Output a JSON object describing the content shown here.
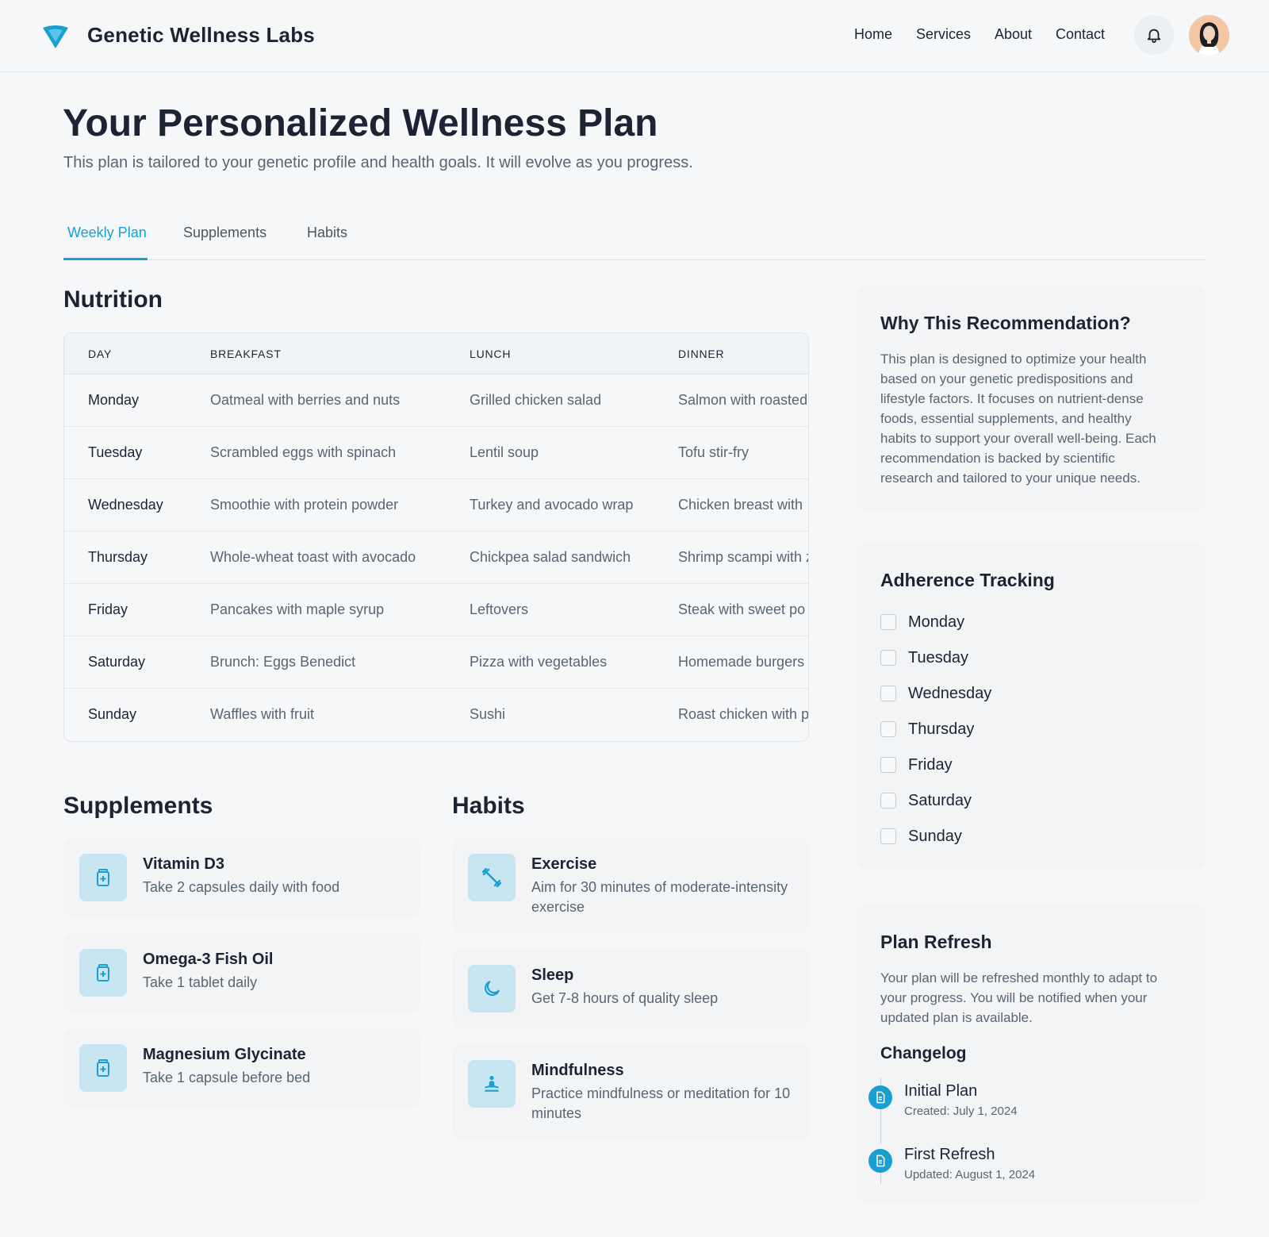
{
  "brand": {
    "name": "Genetic Wellness Labs",
    "accent": "#1a9fd2"
  },
  "nav": {
    "home": "Home",
    "services": "Services",
    "about": "About",
    "contact": "Contact"
  },
  "page": {
    "title": "Your Personalized Wellness Plan",
    "subtitle": "This plan is tailored to your genetic profile and health goals. It will evolve as you progress."
  },
  "tabs": [
    {
      "label": "Weekly Plan",
      "active": true
    },
    {
      "label": "Supplements",
      "active": false
    },
    {
      "label": "Habits",
      "active": false
    }
  ],
  "nutrition": {
    "heading": "Nutrition",
    "columns": [
      "DAY",
      "BREAKFAST",
      "LUNCH",
      "DINNER"
    ],
    "rows": [
      {
        "day": "Monday",
        "breakfast": "Oatmeal with berries and nuts",
        "lunch": "Grilled chicken salad",
        "dinner": "Salmon with roasted"
      },
      {
        "day": "Tuesday",
        "breakfast": "Scrambled eggs with spinach",
        "lunch": "Lentil soup",
        "dinner": "Tofu stir-fry"
      },
      {
        "day": "Wednesday",
        "breakfast": "Smoothie with protein powder",
        "lunch": "Turkey and avocado wrap",
        "dinner": "Chicken breast with"
      },
      {
        "day": "Thursday",
        "breakfast": "Whole-wheat toast with avocado",
        "lunch": "Chickpea salad sandwich",
        "dinner": "Shrimp scampi with z"
      },
      {
        "day": "Friday",
        "breakfast": "Pancakes with maple syrup",
        "lunch": "Leftovers",
        "dinner": "Steak with sweet po"
      },
      {
        "day": "Saturday",
        "breakfast": "Brunch: Eggs Benedict",
        "lunch": "Pizza with vegetables",
        "dinner": "Homemade burgers"
      },
      {
        "day": "Sunday",
        "breakfast": "Waffles with fruit",
        "lunch": "Sushi",
        "dinner": "Roast chicken with p"
      }
    ]
  },
  "supplements": {
    "heading": "Supplements",
    "items": [
      {
        "name": "Vitamin D3",
        "desc": "Take 2 capsules daily with food",
        "icon": "pill-bottle-icon"
      },
      {
        "name": "Omega-3 Fish Oil",
        "desc": "Take 1 tablet daily",
        "icon": "pill-bottle-icon"
      },
      {
        "name": "Magnesium Glycinate",
        "desc": "Take 1 capsule before bed",
        "icon": "pill-bottle-icon"
      }
    ]
  },
  "habits": {
    "heading": "Habits",
    "items": [
      {
        "name": "Exercise",
        "desc_line1": "Aim for 30 minutes of moderate-intensity",
        "desc_line2": "exercise",
        "icon": "dumbbell-icon"
      },
      {
        "name": "Sleep",
        "desc_line1": "Get 7-8 hours of quality sleep",
        "icon": "moon-icon"
      },
      {
        "name": "Mindfulness",
        "desc_line1": "Practice mindfulness or meditation for 10",
        "desc_line2": "minutes",
        "icon": "meditation-icon"
      }
    ]
  },
  "why": {
    "title": "Why This Recommendation?",
    "lines": [
      "This plan is designed to optimize your health",
      "based on your genetic predispositions and",
      "lifestyle factors. It focuses on nutrient-dense",
      "foods, essential supplements, and healthy",
      "habits to support your overall well-being. Each",
      "recommendation is backed by scientific",
      "research and tailored to your unique needs."
    ]
  },
  "adherence": {
    "title": "Adherence Tracking",
    "days": [
      "Monday",
      "Tuesday",
      "Wednesday",
      "Thursday",
      "Friday",
      "Saturday",
      "Sunday"
    ]
  },
  "refresh": {
    "title": "Plan Refresh",
    "lines": [
      "Your plan will be refreshed monthly to adapt to",
      "your progress. You will be notified when your",
      "updated plan is available."
    ],
    "changelog_title": "Changelog",
    "changelog": [
      {
        "title": "Initial Plan",
        "date": "Created: July 1, 2024"
      },
      {
        "title": "First Refresh",
        "date": "Updated: August 1, 2024"
      }
    ]
  }
}
